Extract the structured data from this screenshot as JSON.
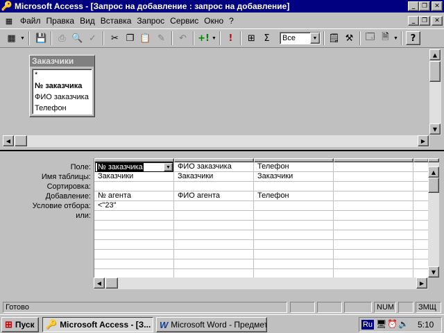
{
  "window": {
    "title": "Microsoft Access - [Запрос на добавление : запрос на добавление]"
  },
  "menu": {
    "items": [
      "Файл",
      "Правка",
      "Вид",
      "Вставка",
      "Запрос",
      "Сервис",
      "Окно",
      "?"
    ]
  },
  "toolbar": {
    "top_values": "Все"
  },
  "field_list": {
    "title": "Заказчики",
    "fields": [
      "*",
      "№ заказчика",
      "ФИО заказчика",
      "Телефон"
    ]
  },
  "grid": {
    "row_labels": [
      "Поле:",
      "Имя таблицы:",
      "Сортировка:",
      "Добавление:",
      "Условие отбора:",
      "или:"
    ],
    "columns": [
      {
        "field": "№ заказчика",
        "table": "Заказчики",
        "sort": "",
        "append_to": "№ агента",
        "criteria": "<\"23\""
      },
      {
        "field": "ФИО заказчика",
        "table": "Заказчики",
        "sort": "",
        "append_to": "ФИО агента",
        "criteria": ""
      },
      {
        "field": "Телефон",
        "table": "Заказчики",
        "sort": "",
        "append_to": "Телефон",
        "criteria": ""
      }
    ]
  },
  "status": {
    "text": "Готово",
    "num": "NUM",
    "ovr": "ЗМЩ"
  },
  "taskbar": {
    "start_label": "Пуск",
    "tasks": [
      "Microsoft Access - [З...",
      "Microsoft Word - Предмет..."
    ],
    "lang": "Ru",
    "clock": "5:10"
  }
}
